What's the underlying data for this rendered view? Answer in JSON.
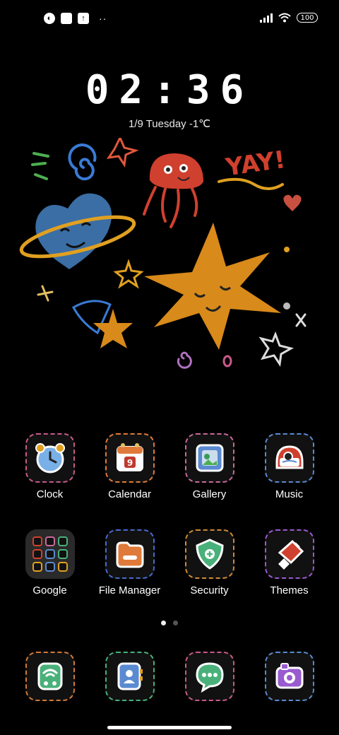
{
  "status_bar": {
    "left_icons": [
      "notification-icon",
      "app-icon",
      "upload-icon"
    ],
    "overflow": "··",
    "battery": "100"
  },
  "lock": {
    "time": "02:36",
    "date": "1/9  Tuesday  -1℃"
  },
  "artwork_text": "YAY!",
  "apps_row1": [
    {
      "label": "Clock",
      "icon": "clock-icon",
      "color": "#c85a8a"
    },
    {
      "label": "Calendar",
      "icon": "calendar-icon",
      "color": "#e07a3a"
    },
    {
      "label": "Gallery",
      "icon": "gallery-icon",
      "color": "#c86a9a"
    },
    {
      "label": "Music",
      "icon": "music-icon",
      "color": "#5a8ad0"
    }
  ],
  "apps_row2": [
    {
      "label": "Google",
      "icon": "google-folder-icon"
    },
    {
      "label": "File Manager",
      "icon": "folder-icon",
      "color": "#4a6ad0"
    },
    {
      "label": "Security",
      "icon": "shield-icon",
      "color": "#d08a3a"
    },
    {
      "label": "Themes",
      "icon": "theme-icon",
      "color": "#9a5ad0"
    }
  ],
  "dock": [
    {
      "icon": "phone-icon",
      "color": "#d07a3a"
    },
    {
      "icon": "contacts-icon",
      "color": "#4ab07a"
    },
    {
      "icon": "messages-icon",
      "color": "#c85a8a"
    },
    {
      "icon": "camera-icon",
      "color": "#5a8ad0"
    }
  ],
  "pages": {
    "count": 2,
    "active": 0
  }
}
